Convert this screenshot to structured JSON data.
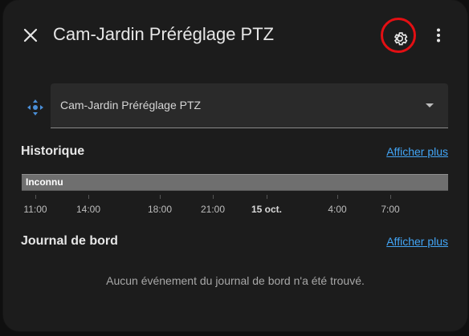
{
  "dialog": {
    "title": "Cam-Jardin Préréglage PTZ",
    "icons": {
      "close": "close-icon",
      "settings": "gear-icon",
      "more": "more-vert-icon",
      "entity": "pan-tilt-icon"
    }
  },
  "select": {
    "value": "Cam-Jardin Préréglage PTZ"
  },
  "history": {
    "title": "Historique",
    "show_more": "Afficher plus",
    "state_label": "Inconnu",
    "ticks": [
      "11:00",
      "14:00",
      "18:00",
      "21:00",
      "15 oct.",
      "4:00",
      "7:00"
    ]
  },
  "logbook": {
    "title": "Journal de bord",
    "show_more": "Afficher plus",
    "empty_message": "Aucun événement du journal de bord n'a été trouvé."
  },
  "colors": {
    "accent_link": "#42a5f5",
    "highlight_ring": "#e30f13",
    "timeline_state": "#6f6f6f",
    "dialog_bg": "#1c1c1c"
  }
}
